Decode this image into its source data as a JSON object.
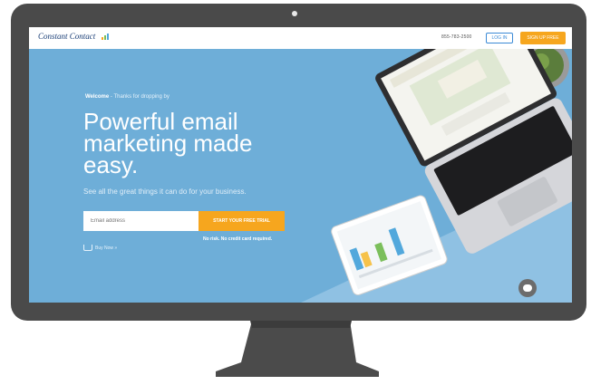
{
  "nav": {
    "logo_text": "Constant Contact",
    "phone": "855-783-2500",
    "login_label": "LOG IN",
    "signup_label": "SIGN UP FREE"
  },
  "hero": {
    "welcome_bold": "Welcome",
    "welcome_rest": " - Thanks for dropping by",
    "headline": "Powerful email marketing made easy.",
    "subline": "See all the great things it can do for your business.",
    "email_placeholder": "Email address",
    "trial_label": "START YOUR FREE TRIAL",
    "no_risk": "No risk. No credit card required.",
    "buy_label": "Buy Now »"
  },
  "colors": {
    "screen_bg": "#6eaed8",
    "accent_orange": "#f6a61e",
    "monitor": "#4a4a4a",
    "brand_blue": "#1b3f77"
  }
}
